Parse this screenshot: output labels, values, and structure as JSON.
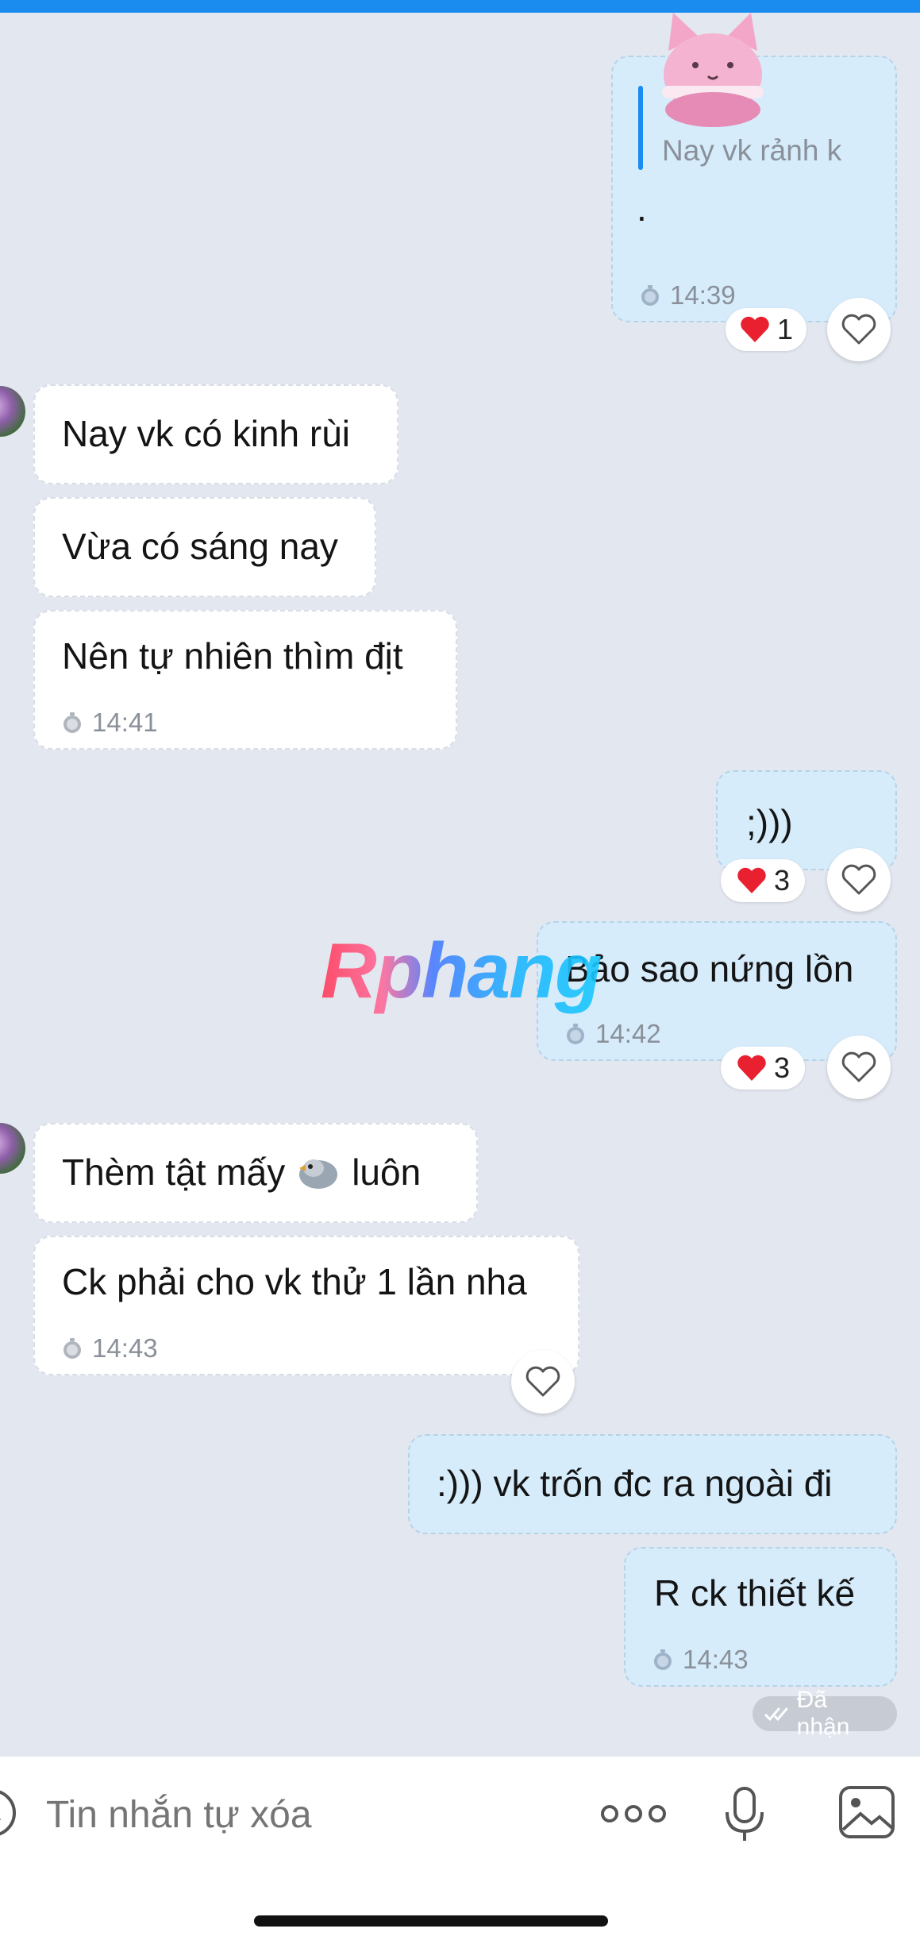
{
  "messages": {
    "m1": {
      "quote": "Nay vk rảnh k",
      "text": ".",
      "time": "14:39",
      "reaction_count": "1"
    },
    "m2": {
      "text": "Nay vk có kinh rùi"
    },
    "m3": {
      "text": "Vừa có sáng nay"
    },
    "m4": {
      "text": "Nên tự nhiên thìm địt",
      "time": "14:41"
    },
    "m5": {
      "text": ";)))",
      "reaction_count": "3"
    },
    "m6": {
      "text": "Bảo sao nứng lồn",
      "time": "14:42",
      "reaction_count": "3"
    },
    "m7": {
      "text": "Thèm tật mấy",
      "text_after": "luôn"
    },
    "m8": {
      "text": "Ck phải cho vk thử 1 lần nha",
      "time": "14:43"
    },
    "m9": {
      "text": ":))) vk trốn đc ra ngoài đi"
    },
    "m10": {
      "text": "R ck thiết kế",
      "time": "14:43"
    }
  },
  "status": {
    "label": "Đã nhận"
  },
  "watermark": {
    "text": "Rphang"
  },
  "input": {
    "placeholder": "Tin nhắn tự xóa"
  },
  "icons": {
    "reaction": "red-heart-emoji",
    "heart_button": "heart-outline-icon",
    "time": "stopwatch-icon",
    "bird": "bird-emoji",
    "sticker": "pink-cat-macaron-sticker",
    "more": "more-dots-icon",
    "mic": "microphone-icon",
    "image": "image-icon",
    "emoji": "emoji-icon"
  },
  "colors": {
    "accent": "#1a8cf0",
    "outgoing_bubble": "#d6ecfb",
    "incoming_bubble": "#ffffff",
    "background": "#e3e7ef",
    "heart": "#e8202f"
  }
}
